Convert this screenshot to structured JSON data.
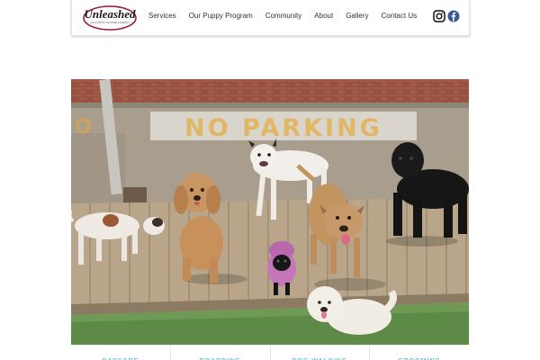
{
  "header": {
    "logo": {
      "text": "Unleashed",
      "tagline": "A NYC PUPPY DAYCARE COMPANY"
    },
    "nav": [
      "Services",
      "Our Puppy Program",
      "Community",
      "About",
      "Gallery",
      "Contact Us"
    ],
    "social": [
      "instagram-icon",
      "facebook-icon"
    ]
  },
  "hero": {
    "sign_text": "NO PARKING"
  },
  "tiles": [
    "DAYCARE",
    "BOARDING",
    "DOG WALKING",
    "GROOMING"
  ],
  "colors": {
    "brand_red": "#9b1b30",
    "tile_accent": "#6bc3c9",
    "facebook": "#3b5998"
  }
}
